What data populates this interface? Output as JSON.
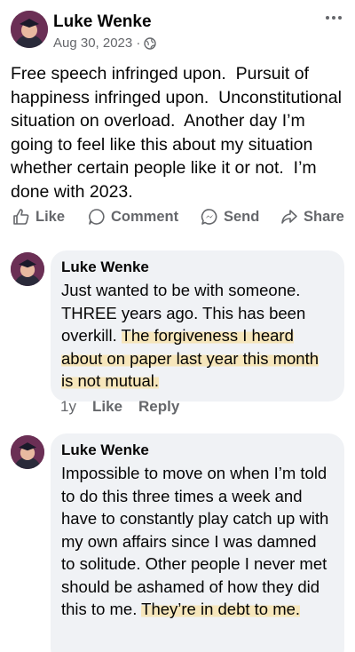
{
  "post": {
    "author": "Luke Wenke",
    "date": "Aug 30, 2023 ·",
    "audience_icon": "globe-icon",
    "more_icon": "more-horizontal-icon",
    "text": "Free speech infringed upon.  Pursuit of happiness infringed upon.  Unconstitutional situation on overload.  Another day I’m going to feel like this about my situation whether certain people like it or not.  I’m done with 2023."
  },
  "actions": {
    "like": "Like",
    "comment": "Comment",
    "send": "Send",
    "share": "Share"
  },
  "comments": [
    {
      "author": "Luke Wenke",
      "text_plain": "Just wanted to be with someone. THREE years ago.  This has been overkill.  ",
      "text_highlight": "The forgiveness I heard about on paper last year this month is not mutual.",
      "time": "1y",
      "like": "Like",
      "reply": "Reply"
    },
    {
      "author": "Luke Wenke",
      "text_plain": "Impossible to move on when I’m told to do this three times a week and have to constantly play catch up with my own affairs since I was damned to solitude.  Other people I never met should be ashamed of how they did this to me.  ",
      "text_highlight": "They’re in debt to me."
    }
  ],
  "colors": {
    "text": "#050505",
    "secondary": "#65676b",
    "bubble": "#f0f2f5",
    "highlight": "#fadc8c"
  }
}
